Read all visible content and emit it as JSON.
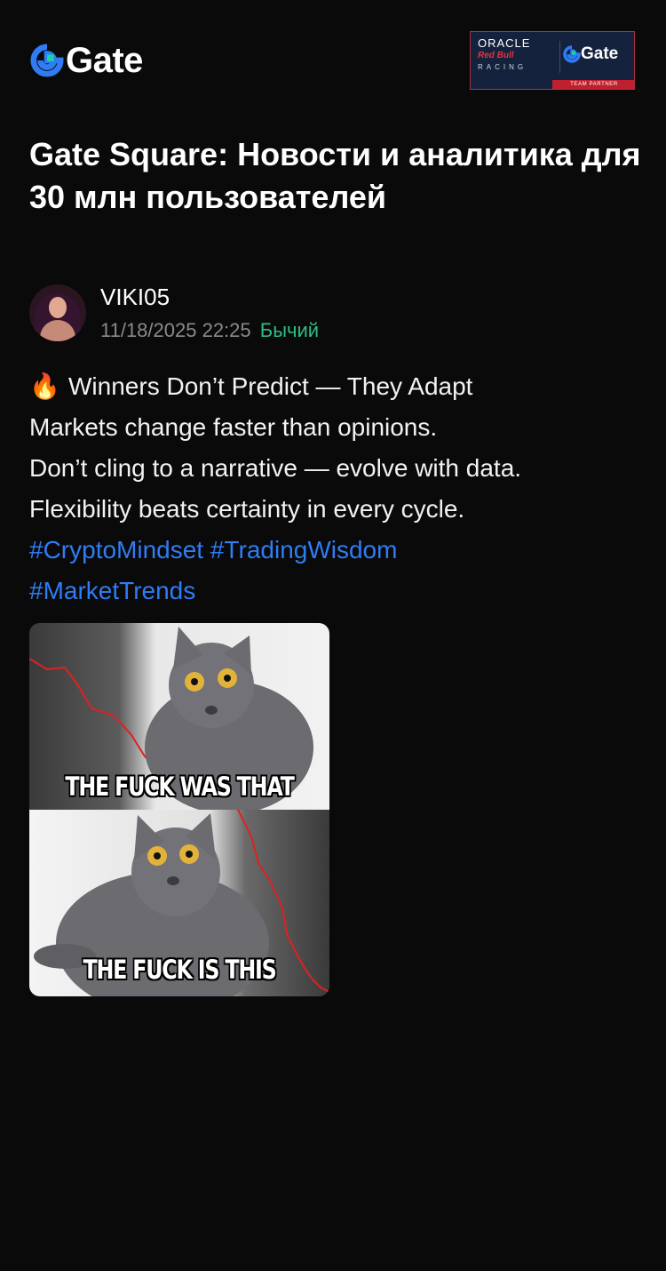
{
  "header": {
    "logo_text": "Gate",
    "partner_badge": {
      "oracle": "ORACLE",
      "redbull": "Red Bull",
      "racing": "RACING",
      "gate": "Gate",
      "strip": "TEAM PARTNER"
    }
  },
  "page_title": "Gate Square: Новости и аналитика для 30 млн пользователей",
  "post": {
    "author": "VIKI05",
    "timestamp": "11/18/2025 22:25",
    "sentiment": "Бычий",
    "lines": [
      "Winners Don’t Predict — They Adapt",
      "Markets change faster than opinions.",
      "Don’t cling to a narrative — evolve with data.",
      "Flexibility beats certainty in every cycle."
    ],
    "emoji": "🔥",
    "hashtags_line1": "#CryptoMindset #TradingWisdom",
    "hashtags_line2": "#MarketTrends",
    "meme": {
      "caption_top": "THE FUCK WAS THAT",
      "caption_bottom": "THE FUCK IS THIS"
    }
  },
  "colors": {
    "background": "#0a0a0a",
    "accent_blue": "#2f7cf5",
    "bullish_green": "#2ebd85",
    "muted_gray": "#8a8a8a"
  },
  "icons": [
    "gate-logo-icon",
    "fire-emoji-icon"
  ]
}
